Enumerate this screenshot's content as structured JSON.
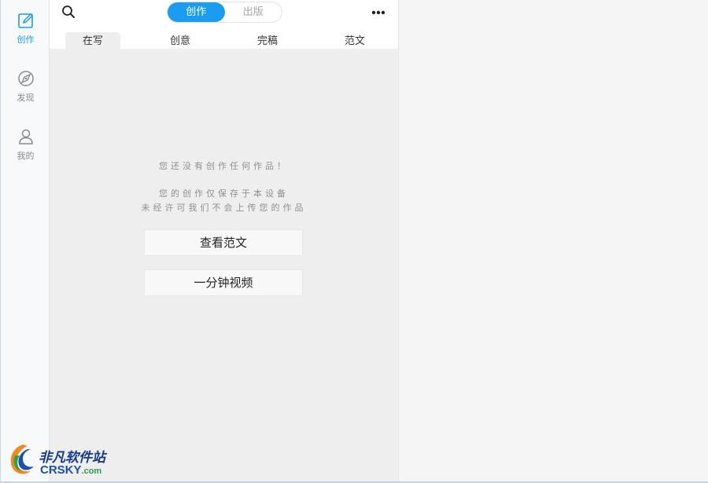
{
  "sidebar": {
    "items": [
      {
        "label": "创作",
        "icon": "edit-icon",
        "active": true
      },
      {
        "label": "发现",
        "icon": "compass-icon",
        "active": false
      },
      {
        "label": "我的",
        "icon": "user-icon",
        "active": false
      }
    ]
  },
  "header": {
    "segments": [
      {
        "label": "创作",
        "active": true
      },
      {
        "label": "出版",
        "active": false
      }
    ],
    "search_icon": "search-icon",
    "more_icon": "more-icon"
  },
  "tabs": [
    {
      "label": "在写",
      "active": true
    },
    {
      "label": "创意",
      "active": false
    },
    {
      "label": "完稿",
      "active": false
    },
    {
      "label": "范文",
      "active": false
    }
  ],
  "empty_state": {
    "line1": "您还没有创作任何作品！",
    "line2": "您的创作仅保存于本设备",
    "line3": "未经许可我们不会上传您的作品"
  },
  "actions": {
    "view_samples": "查看范文",
    "one_minute_video": "一分钟视频"
  },
  "watermark": {
    "cn": "非凡软件站",
    "en": "CRSKY",
    "en_suffix": ".com"
  },
  "colors": {
    "accent": "#1a9cf0",
    "panel_bg": "#eeeeee"
  }
}
